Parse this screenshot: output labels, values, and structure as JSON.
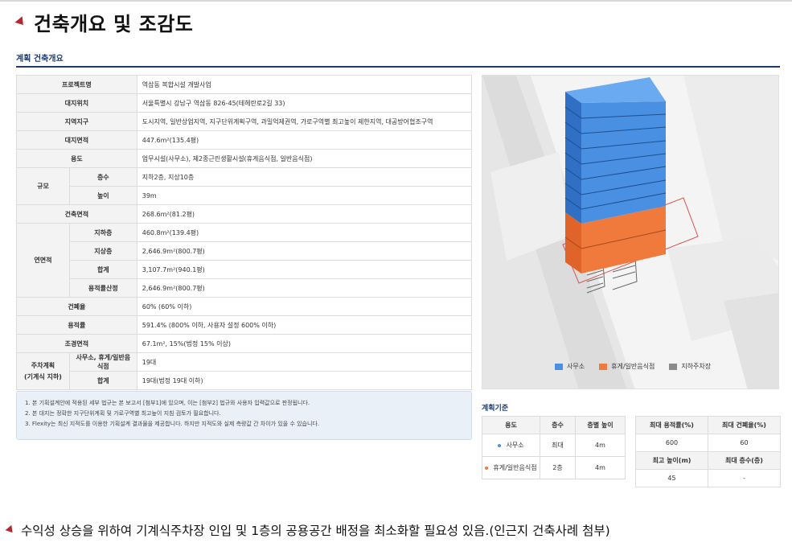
{
  "title": "건축개요 및 조감도",
  "section_label": "계획 건축개요",
  "spec": {
    "project_label": "프로젝트명",
    "project_value": "역삼동 복합시설 개발사업",
    "site_label": "대지위치",
    "site_value": "서울특별시 강남구 역삼동 826-45(테헤란로2길 33)",
    "zone_label": "지역지구",
    "zone_value": "도시지역, 일반상업지역, 지구단위계획구역, 과밀억제권역, 가로구역별 최고높이 제한지역, 대공방어협조구역",
    "area_label": "대지면적",
    "area_value": "447.6m²(135.4평)",
    "use_label": "용도",
    "use_value": "업무시설(사무소), 제2종근린생활시설(휴게음식점, 일반음식점)",
    "scale_label": "규모",
    "floors_label": "층수",
    "floors_value": "지하2층, 지상10층",
    "height_label": "높이",
    "height_value": "39m",
    "building_area_label": "건축면적",
    "building_area_value": "268.6m²(81.2평)",
    "gfa_label": "연면적",
    "basement_label": "지하층",
    "basement_value": "460.8m²(139.4평)",
    "above_label": "지상층",
    "above_value": "2,646.9m²(800.7평)",
    "total_label": "합계",
    "total_value": "3,107.7m²(940.1평)",
    "far_area_label": "용적률산정",
    "far_area_value": "2,646.9m²(800.7평)",
    "bcr_label": "건폐율",
    "bcr_value": "60% (60% 이하)",
    "far_label": "용적률",
    "far_value": "591.4% (800% 이하, 사용자 설정 600% 이하)",
    "landscape_label": "조경면적",
    "landscape_value": "67.1m², 15%(법정 15% 이상)",
    "parking_label_1": "주차계획",
    "parking_label_2": "(기계식 지하)",
    "parking_office_label": "사무소, 휴게/일반음식점",
    "parking_office_value": "19대",
    "parking_total_label": "합계",
    "parking_total_value": "19대(법정 19대 이하)"
  },
  "notes": [
    "1. 본 기획설계안에 적용된 세부 법규는 본 보고서 [첨부1]에 있으며, 이는 [첨부2] 법규와 사용자 입력값으로 판정됩니다.",
    "2. 본 대지는 정확한 지구단위계획 및 가로구역별 최고높이 지침 검토가 필요합니다.",
    "3. Flexity는 최신 지적도를 이용한 기획설계 결과물을 제공합니다. 하지만 지적도와 실제 측량값 간 차이가 있을 수 있습니다."
  ],
  "legend": {
    "office": "사무소",
    "office_color": "#4a90e2",
    "restaurant": "휴게/일반음식점",
    "restaurant_color": "#f07a3c",
    "parking": "지하주차장",
    "parking_color": "#8a8a8a"
  },
  "plan_label": "계획기준",
  "plan_table": {
    "headers": [
      "용도",
      "층수",
      "층별 높이"
    ],
    "rows": [
      {
        "use": "사무소",
        "floors": "최대",
        "height": "4m",
        "color": "#4a90e2"
      },
      {
        "use": "휴게/일반음식점",
        "floors": "2층",
        "height": "4m",
        "color": "#f07a3c"
      }
    ]
  },
  "ratio_table": {
    "far_header": "최대 용적률(%)",
    "bcr_header": "최대 건폐율(%)",
    "far_value": "600",
    "bcr_value": "60",
    "height_header": "최고 높이(m)",
    "floors_header": "최대 층수(층)",
    "height_value": "45",
    "floors_value": "-"
  },
  "bottom_text": "수익성 상승을 위하여 기계식주차장 인입 및 1층의 공용공간 배정을 최소화할 필요성 있음.(인근지 건축사례 첨부)"
}
